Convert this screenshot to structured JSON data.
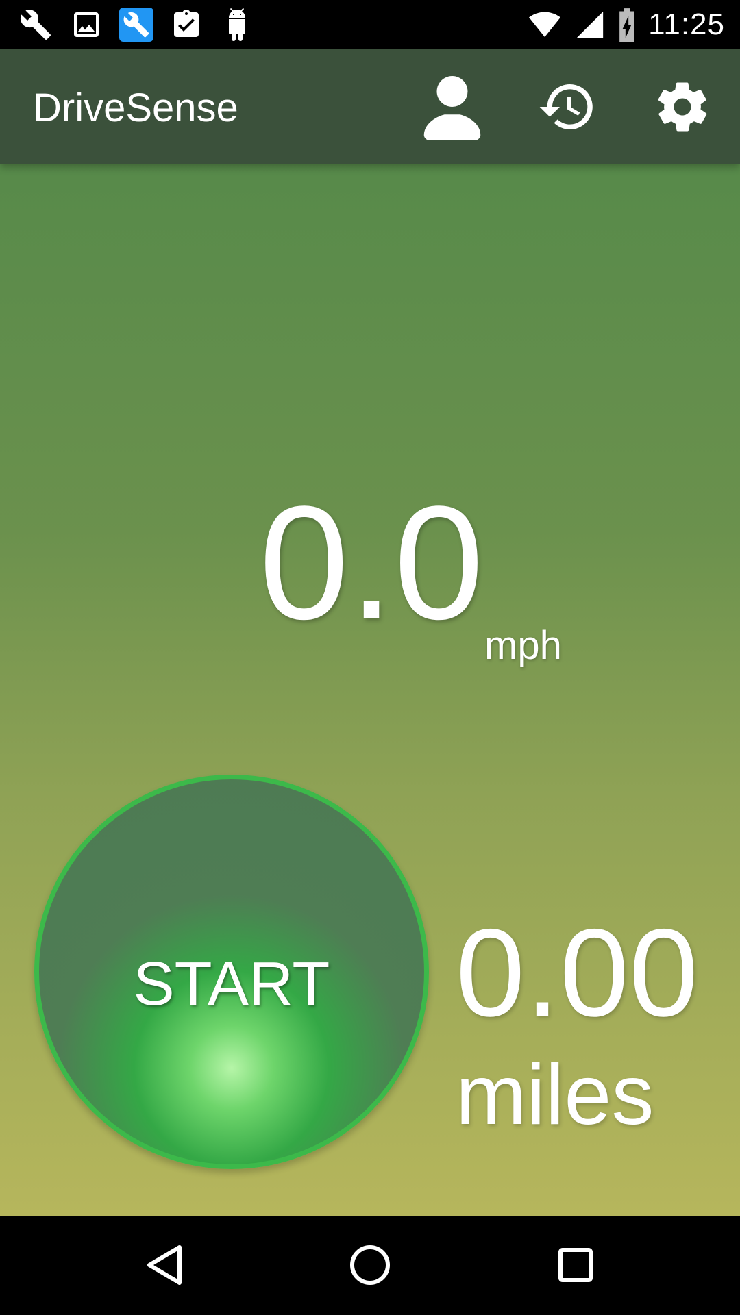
{
  "status_bar": {
    "notification_icons": [
      "wrench-icon",
      "image-icon",
      "wrench-blue-icon",
      "clipboard-check-icon",
      "android-icon"
    ],
    "time": "11:25"
  },
  "app_bar": {
    "title": "DriveSense",
    "actions": [
      "profile-icon",
      "history-icon",
      "settings-icon"
    ]
  },
  "main": {
    "speed_value": "0.0",
    "speed_unit": "mph",
    "start_label": "START",
    "distance_value": "0.00",
    "distance_unit": "miles"
  },
  "colors": {
    "app_bar": "#3b513b",
    "gradient_top": "#578a4a",
    "gradient_bottom": "#b6b65c",
    "start_ring": "#3cb94a"
  },
  "nav_bar": [
    "back-icon",
    "home-icon",
    "recents-icon"
  ]
}
